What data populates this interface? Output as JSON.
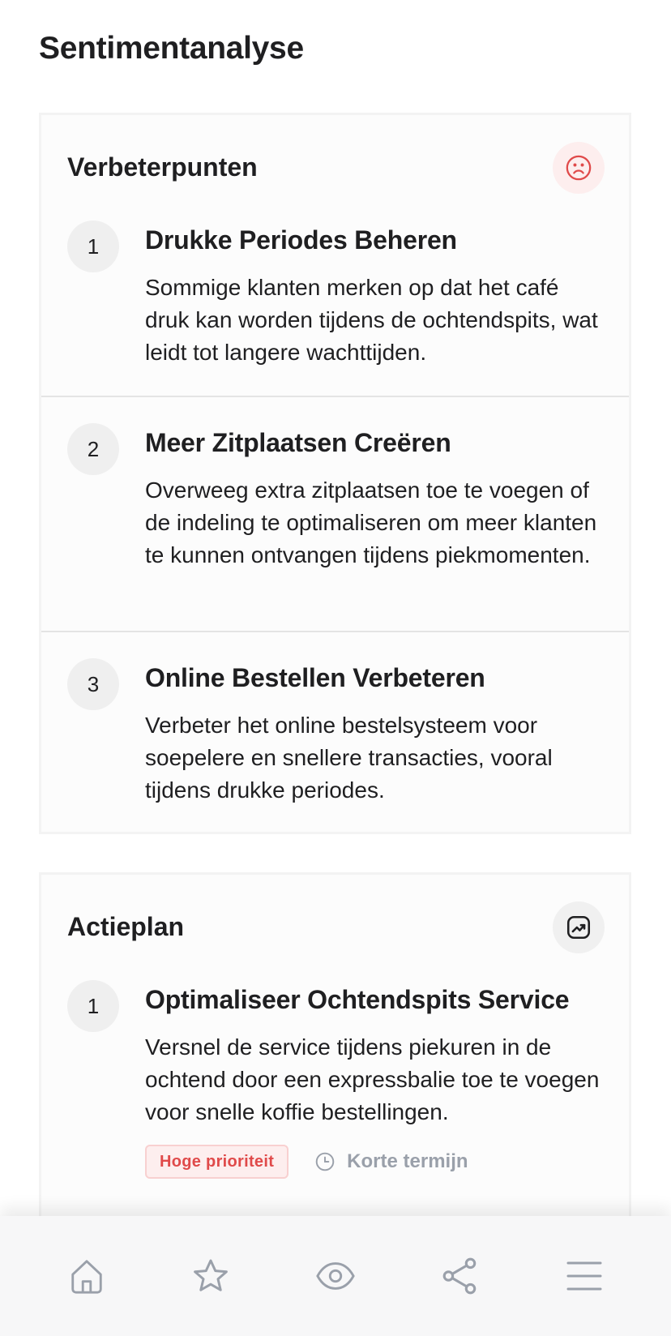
{
  "page": {
    "title": "Sentimentanalyse"
  },
  "colors": {
    "accent_red": "#e04a4a",
    "muted": "#9aa0aa",
    "text": "#1f1f21"
  },
  "improvements": {
    "title": "Verbeterpunten",
    "icon": "sad-face-icon",
    "items": [
      {
        "number": "1",
        "title": "Drukke Periodes Beheren",
        "description": "Sommige klanten merken op dat het café druk kan worden tijdens de ochtendspits, wat leidt tot langere wachttijden."
      },
      {
        "number": "2",
        "title": "Meer Zitplaatsen Creëren",
        "description": "Overweeg extra zitplaatsen toe te voegen of de indeling te optimaliseren om meer klanten te kunnen ontvangen tijdens piekmomenten."
      },
      {
        "number": "3",
        "title": "Online Bestellen Verbeteren",
        "description": "Verbeter het online bestelsysteem voor soepelere en snellere transacties, vooral tijdens drukke periodes."
      }
    ]
  },
  "action_plan": {
    "title": "Actieplan",
    "icon": "trending-up-icon",
    "items": [
      {
        "number": "1",
        "title": "Optimaliseer Ochtendspits Service",
        "description": "Versnel de service tijdens piekuren in de ochtend door een expressbalie toe te voegen voor snelle koffie bestellingen.",
        "priority": "Hoge prioriteit",
        "term": "Korte termijn"
      }
    ]
  },
  "bottom_nav": {
    "items": [
      {
        "icon": "home-icon"
      },
      {
        "icon": "star-icon"
      },
      {
        "icon": "eye-icon"
      },
      {
        "icon": "share-icon"
      },
      {
        "icon": "menu-icon"
      }
    ]
  }
}
